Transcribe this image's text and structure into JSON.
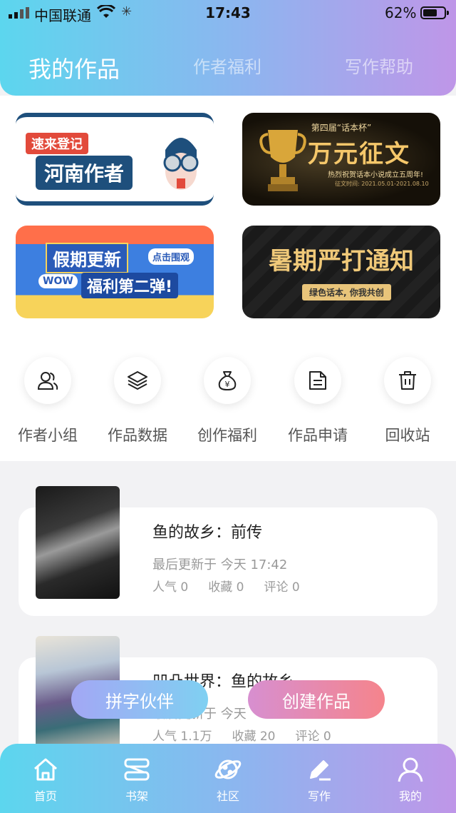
{
  "status_bar": {
    "carrier": "中国联通",
    "time": "17:43",
    "battery": "62%"
  },
  "tabs": [
    {
      "label": "我的作品",
      "active": true
    },
    {
      "label": "作者福利",
      "active": false
    },
    {
      "label": "写作帮助",
      "active": false
    }
  ],
  "banners": [
    {
      "tag": "速来登记",
      "title": "河南作者"
    },
    {
      "subtitle": "第四届“话本杯”",
      "title": "万元征文",
      "caption": "热烈祝贺话本小说成立五周年!",
      "dates": "征文时间: 2021.05.01-2021.08.10"
    },
    {
      "title_1": "假期更新",
      "title_2": "福利第二弹!",
      "badge": "WOW",
      "popup": "点击围观"
    },
    {
      "title": "暑期严打通知",
      "subtitle": "绿色话本, 你我共创"
    }
  ],
  "quick_actions": [
    {
      "label": "作者小组",
      "icon": "users-icon"
    },
    {
      "label": "作品数据",
      "icon": "layers-icon"
    },
    {
      "label": "创作福利",
      "icon": "money-bag-icon"
    },
    {
      "label": "作品申请",
      "icon": "document-icon"
    },
    {
      "label": "回收站",
      "icon": "trash-icon"
    }
  ],
  "works": [
    {
      "title": "鱼的故乡：前传",
      "updated": "最后更新于 今天 17:42",
      "popularity": "人气 0",
      "favorites": "收藏 0",
      "comments": "评论 0"
    },
    {
      "title": "凹凸世界：鱼的故乡",
      "updated": "最后更新于 今天",
      "popularity": "人气 1.1万",
      "favorites": "收藏 20",
      "comments": "评论 0"
    }
  ],
  "floating_buttons": {
    "partner": "拼字伙伴",
    "create": "创建作品"
  },
  "bottom_nav": [
    {
      "label": "首页",
      "icon": "home-icon"
    },
    {
      "label": "书架",
      "icon": "bookshelf-icon"
    },
    {
      "label": "社区",
      "icon": "planet-icon"
    },
    {
      "label": "写作",
      "icon": "pen-icon",
      "active": true
    },
    {
      "label": "我的",
      "icon": "profile-icon"
    }
  ],
  "colors": {
    "header_start": "#5cd6ee",
    "header_end": "#bf96e8",
    "create_button": "#f5848c",
    "partner_button": "#7fd0f2"
  }
}
